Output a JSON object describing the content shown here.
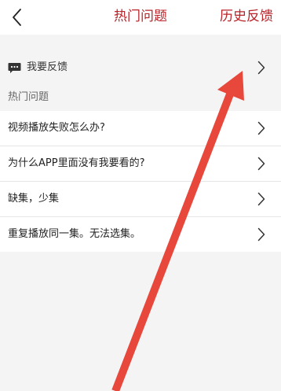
{
  "header": {
    "back_icon": "chevron-left-icon",
    "title": "热门问题",
    "history_label": "历史反馈",
    "accent_color": "#b8242a"
  },
  "feedback": {
    "icon": "chat-bubble-icon",
    "label": "我要反馈"
  },
  "section": {
    "title": "热门问题"
  },
  "faq": {
    "items": [
      {
        "label": "视频播放失败怎么办?"
      },
      {
        "label": "为什么APP里面没有我要看的?"
      },
      {
        "label": "缺集，少集"
      },
      {
        "label": "重复播放同一集。无法选集。"
      }
    ]
  },
  "annotation": {
    "color": "#e8473b"
  }
}
